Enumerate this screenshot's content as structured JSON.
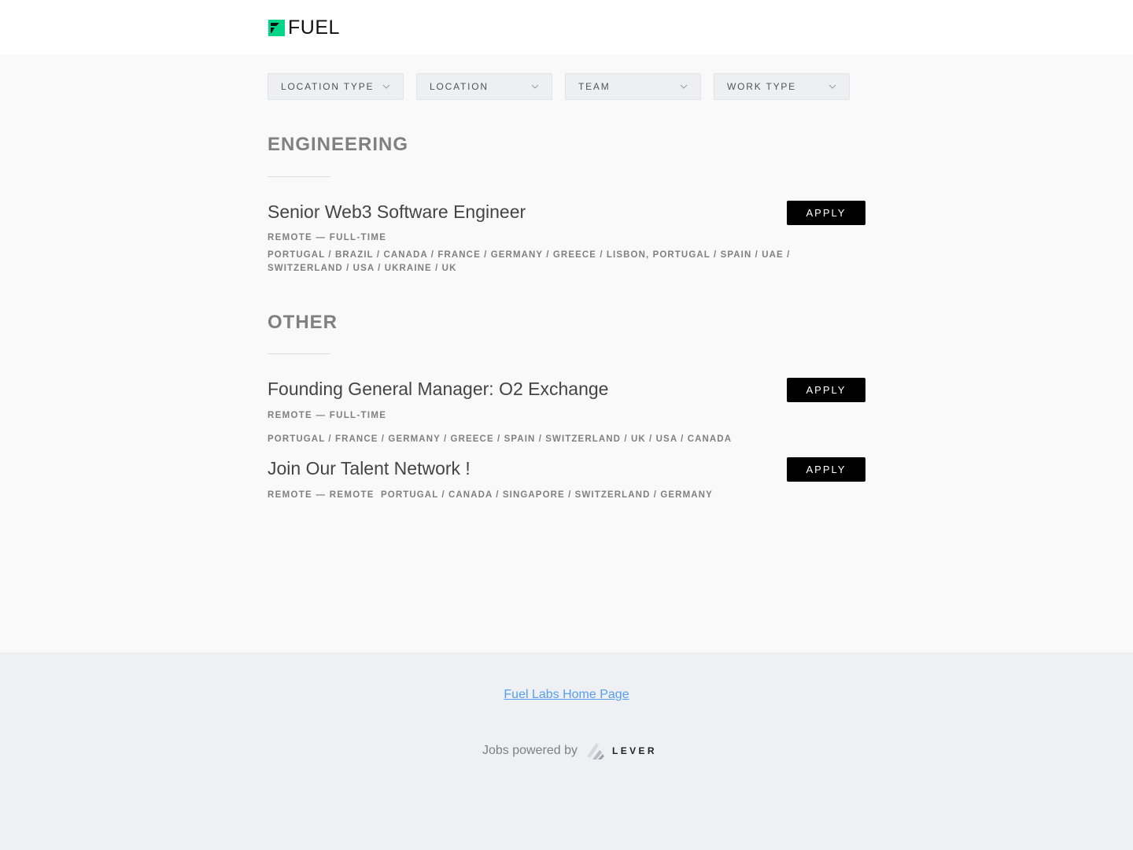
{
  "brand": {
    "name": "FUEL",
    "accent": "#00d588"
  },
  "filters": [
    {
      "label": "LOCATION TYPE"
    },
    {
      "label": "LOCATION"
    },
    {
      "label": "TEAM"
    },
    {
      "label": "WORK TYPE"
    }
  ],
  "groups": [
    {
      "title": "ENGINEERING",
      "postings": [
        {
          "title": "Senior Web3 Software Engineer",
          "meta": "REMOTE — FULL-TIME",
          "locations": "PORTUGAL / BRAZIL / CANADA / FRANCE / GERMANY / GREECE / LISBON, PORTUGAL / SPAIN / UAE / SWITZERLAND / USA / UKRAINE / UK",
          "apply": "APPLY"
        }
      ]
    },
    {
      "title": "OTHER",
      "postings": [
        {
          "title": "Founding General Manager: O2 Exchange",
          "meta": "REMOTE — FULL-TIME",
          "locations": "PORTUGAL / FRANCE / GERMANY / GREECE / SPAIN / SWITZERLAND / UK / USA / CANADA",
          "apply": "APPLY"
        },
        {
          "title": "Join Our Talent Network !",
          "meta": "REMOTE — REMOTE",
          "locations": "PORTUGAL / CANADA / SINGAPORE / SWITZERLAND / GERMANY",
          "apply": "APPLY"
        }
      ]
    }
  ],
  "footer": {
    "home_link": "Fuel Labs Home Page",
    "powered_by": "Jobs powered by",
    "lever": "LEVER"
  }
}
